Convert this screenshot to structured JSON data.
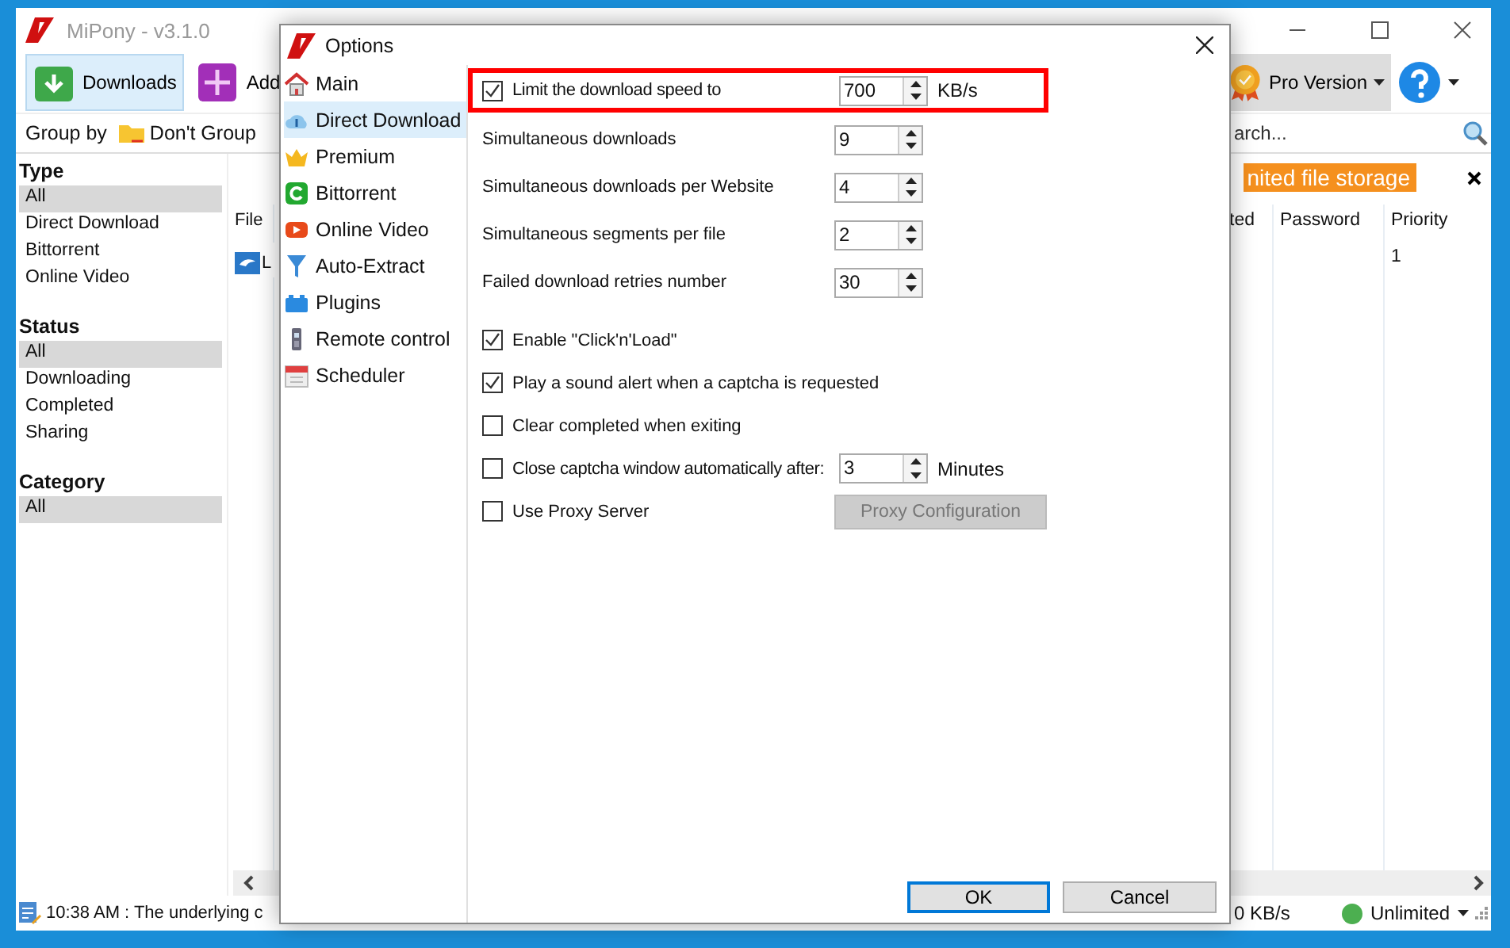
{
  "main_window": {
    "title": "MiPony - v3.1.0",
    "toolbar": [
      {
        "label": "Downloads",
        "kind": "downloads",
        "selected": true
      },
      {
        "label": "Add",
        "kind": "add",
        "selected": false
      }
    ],
    "pro_button": "Pro Version",
    "group_by": {
      "label": "Group by",
      "value": "Don't Group"
    },
    "search": {
      "placeholder": "arch..."
    },
    "sidebar": [
      {
        "heading": "Type",
        "items": [
          {
            "label": "All",
            "selected": true
          },
          {
            "label": "Direct Download",
            "selected": false
          },
          {
            "label": "Bittorrent",
            "selected": false
          },
          {
            "label": "Online Video",
            "selected": false
          }
        ]
      },
      {
        "heading": "Status",
        "items": [
          {
            "label": "All",
            "selected": true
          },
          {
            "label": "Downloading",
            "selected": false
          },
          {
            "label": "Completed",
            "selected": false
          },
          {
            "label": "Sharing",
            "selected": false
          }
        ]
      },
      {
        "heading": "Category",
        "items": [
          {
            "label": "All",
            "selected": true
          }
        ]
      }
    ],
    "banner": "nited file storage",
    "table": {
      "columns": [
        "File",
        "ted",
        "Password",
        "Priority"
      ],
      "rows": [
        {
          "name": "L",
          "priority": "1"
        }
      ]
    },
    "status_bar": {
      "message": "10:38 AM : The underlying c",
      "speed": "0 KB/s",
      "limit": "Unlimited"
    }
  },
  "dialog": {
    "title": "Options",
    "nav": [
      {
        "label": "Main",
        "kind": "main",
        "selected": false
      },
      {
        "label": "Direct Download",
        "kind": "direct",
        "selected": true
      },
      {
        "label": "Premium",
        "kind": "premium",
        "selected": false
      },
      {
        "label": "Bittorrent",
        "kind": "bittorrent",
        "selected": false
      },
      {
        "label": "Online Video",
        "kind": "video",
        "selected": false
      },
      {
        "label": "Auto-Extract",
        "kind": "extract",
        "selected": false
      },
      {
        "label": "Plugins",
        "kind": "plugins",
        "selected": false
      },
      {
        "label": "Remote control",
        "kind": "remote",
        "selected": false
      },
      {
        "label": "Scheduler",
        "kind": "scheduler",
        "selected": false
      }
    ],
    "settings": [
      {
        "kind": "checkbox-spin",
        "label": "Limit the download speed to",
        "checked": true,
        "value": "700",
        "unit": "KB/s",
        "highlighted": true
      },
      {
        "kind": "spin",
        "label": "Simultaneous downloads",
        "value": "9"
      },
      {
        "kind": "spin",
        "label": "Simultaneous downloads per Website",
        "value": "4"
      },
      {
        "kind": "spin",
        "label": "Simultaneous segments per file",
        "value": "2"
      },
      {
        "kind": "spin",
        "label": "Failed download retries number",
        "value": "30"
      },
      {
        "kind": "checkbox",
        "label": "Enable \"Click'n'Load\"",
        "checked": true
      },
      {
        "kind": "checkbox",
        "label": "Play a sound alert when a captcha is requested",
        "checked": true
      },
      {
        "kind": "checkbox",
        "label": "Clear completed when exiting",
        "checked": false
      },
      {
        "kind": "checkbox-spin",
        "label": "Close captcha window automatically after:",
        "checked": false,
        "value": "3",
        "unit": "Minutes"
      },
      {
        "kind": "checkbox-button",
        "label": "Use Proxy Server",
        "checked": false,
        "button": {
          "label": "Proxy Configuration",
          "disabled": true
        }
      }
    ],
    "buttons": [
      {
        "label": "OK",
        "focused": true
      },
      {
        "label": "Cancel",
        "focused": false
      }
    ]
  }
}
